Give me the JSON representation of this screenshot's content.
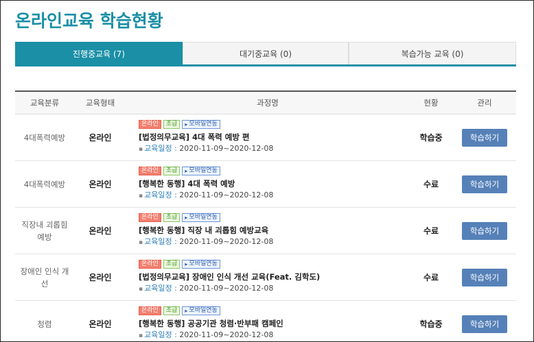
{
  "page_title": "온라인교육 학습현황",
  "tabs": [
    {
      "label": "진행중교육 (7)",
      "active": true
    },
    {
      "label": "대기중교육 (0)",
      "active": false
    },
    {
      "label": "복습가능 교육 (0)",
      "active": false
    }
  ],
  "table": {
    "headers": {
      "category": "교육분류",
      "type": "교육형태",
      "course": "과정명",
      "status": "현황",
      "manage": "관리"
    },
    "badges": {
      "online": "온라인",
      "level": "초급",
      "mobile": "모바일연동"
    },
    "period_label": "교육일정 :",
    "button_label": "학습하기",
    "rows": [
      {
        "category": "4대폭력예방",
        "type": "온라인",
        "title": "[법정의무교육] 4대 폭력 예방 편",
        "period": "2020-11-09~2020-12-08",
        "status": "학습중"
      },
      {
        "category": "4대폭력예방",
        "type": "온라인",
        "title": "[행복한 동행] 4대 폭력 예방",
        "period": "2020-11-09~2020-12-08",
        "status": "수료"
      },
      {
        "category": "직장내 괴롭힘 예방",
        "type": "온라인",
        "title": "[행복한 동행] 직장 내 괴롭힘 예방교육",
        "period": "2020-11-09~2020-12-08",
        "status": "수료"
      },
      {
        "category": "장애인 인식 개선",
        "type": "온라인",
        "title": "[법정의무교육] 장애인 인식 개선 교육(Feat. 김학도)",
        "period": "2020-11-09~2020-12-08",
        "status": "수료"
      },
      {
        "category": "청렴",
        "type": "온라인",
        "title": "[행복한 동행] 공공기관 청렴·반부패 캠페인",
        "period": "2020-11-09~2020-12-08",
        "status": "학습중"
      }
    ]
  },
  "colors": {
    "accent": "#1a8fa6",
    "button": "#5681b8",
    "badge_online": "#f27f6f",
    "badge_level": "#8cc56a",
    "badge_mobile": "#6b95d6"
  }
}
